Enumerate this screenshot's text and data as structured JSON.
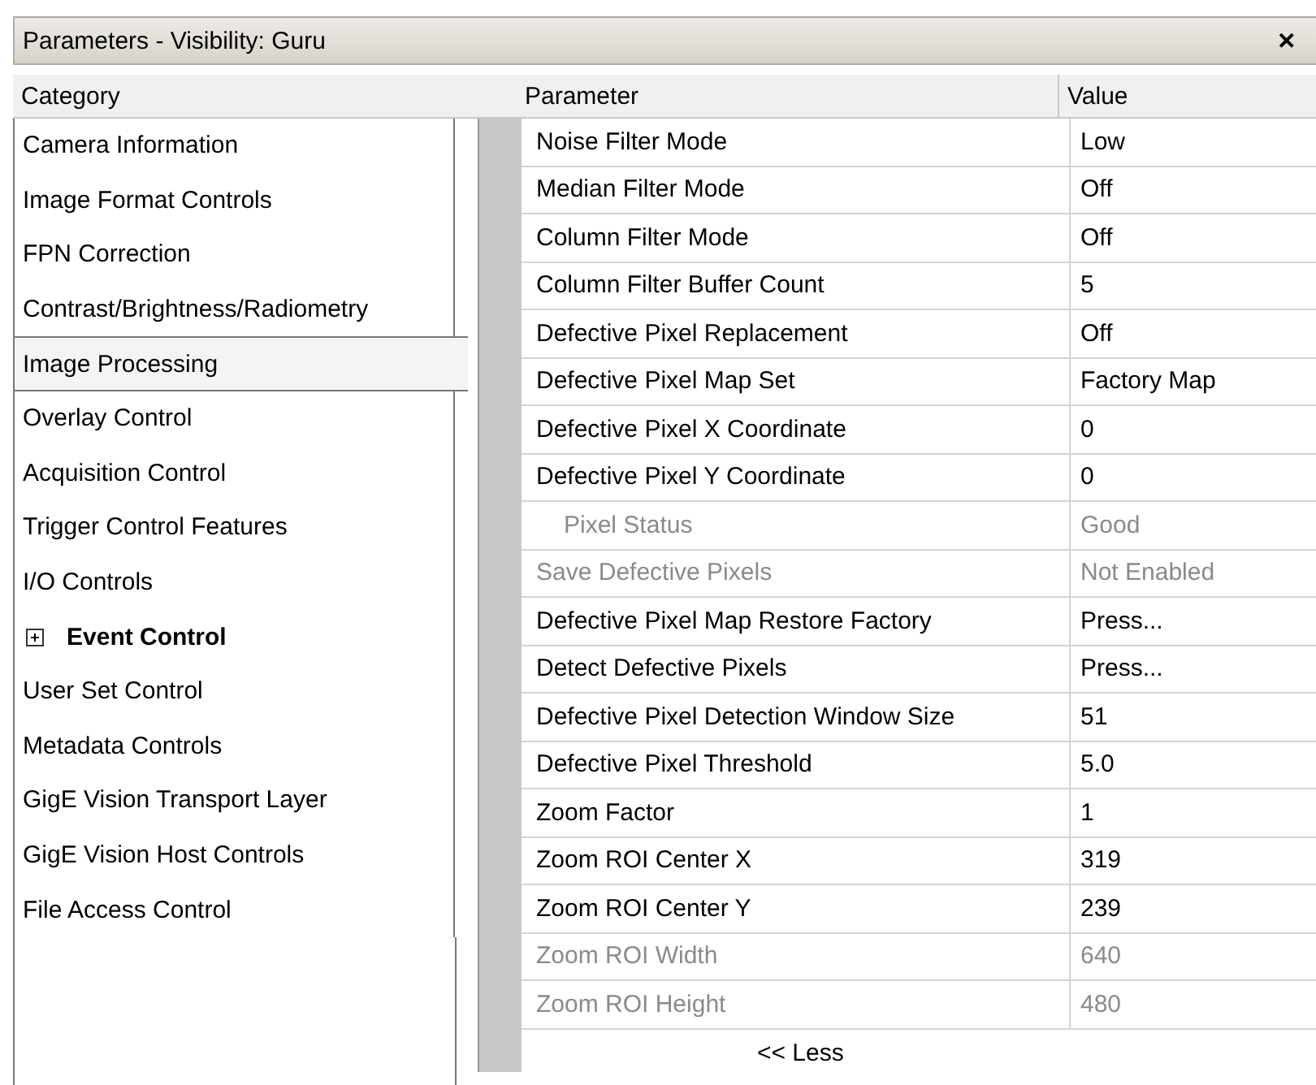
{
  "window": {
    "title": "Parameters - Visibility: Guru",
    "close": "✕"
  },
  "headers": {
    "category": "Category",
    "parameter": "Parameter",
    "value": "Value"
  },
  "categories": [
    {
      "label": "Camera Information",
      "kind": "item",
      "selected": false
    },
    {
      "label": "Image Format Controls",
      "kind": "item",
      "selected": false
    },
    {
      "label": "FPN Correction",
      "kind": "item",
      "selected": false
    },
    {
      "label": "Contrast/Brightness/Radiometry",
      "kind": "item",
      "selected": false
    },
    {
      "label": "Image Processing",
      "kind": "item",
      "selected": true
    },
    {
      "label": "Overlay Control",
      "kind": "item",
      "selected": false
    },
    {
      "label": "Acquisition Control",
      "kind": "item",
      "selected": false
    },
    {
      "label": "Trigger Control Features",
      "kind": "item",
      "selected": false
    },
    {
      "label": "I/O Controls",
      "kind": "item",
      "selected": false
    },
    {
      "label": "Event Control",
      "kind": "group",
      "expanded": false,
      "selected": false
    },
    {
      "label": "User Set Control",
      "kind": "item",
      "selected": false
    },
    {
      "label": "Metadata Controls",
      "kind": "item",
      "selected": false
    },
    {
      "label": "GigE Vision Transport Layer",
      "kind": "item",
      "selected": false
    },
    {
      "label": "GigE Vision Host Controls",
      "kind": "item",
      "selected": false
    },
    {
      "label": "File Access Control",
      "kind": "item",
      "selected": false
    }
  ],
  "parameters": [
    {
      "name": "Noise Filter Mode",
      "value": "Low",
      "disabled": false
    },
    {
      "name": "Median Filter Mode",
      "value": "Off",
      "disabled": false
    },
    {
      "name": "Column Filter Mode",
      "value": "Off",
      "disabled": false
    },
    {
      "name": "Column Filter Buffer Count",
      "value": "5",
      "disabled": false
    },
    {
      "name": "Defective Pixel Replacement",
      "value": "Off",
      "disabled": false
    },
    {
      "name": "Defective Pixel Map Set",
      "value": "Factory Map",
      "disabled": false
    },
    {
      "name": "Defective Pixel X Coordinate",
      "value": "0",
      "disabled": false
    },
    {
      "name": "Defective Pixel Y Coordinate",
      "value": "0",
      "disabled": false,
      "children": [
        {
          "name": "Pixel Status",
          "value": "Good",
          "disabled": true
        }
      ]
    },
    {
      "name": "Save Defective Pixels",
      "value": "Not Enabled",
      "disabled": true
    },
    {
      "name": "Defective Pixel Map Restore Factory",
      "value": "Press...",
      "disabled": false
    },
    {
      "name": "Detect Defective Pixels",
      "value": "Press...",
      "disabled": false
    },
    {
      "name": "Defective Pixel Detection Window Size",
      "value": "51",
      "disabled": false
    },
    {
      "name": "Defective Pixel Threshold",
      "value": "5.0",
      "disabled": false
    },
    {
      "name": "Zoom Factor",
      "value": "1",
      "disabled": false
    },
    {
      "name": "Zoom ROI Center X",
      "value": "319",
      "disabled": false
    },
    {
      "name": "Zoom ROI Center Y",
      "value": "239",
      "disabled": false
    },
    {
      "name": "Zoom ROI Width",
      "value": "640",
      "disabled": true
    },
    {
      "name": "Zoom ROI Height",
      "value": "480",
      "disabled": true
    }
  ],
  "less_button": "<< Less"
}
